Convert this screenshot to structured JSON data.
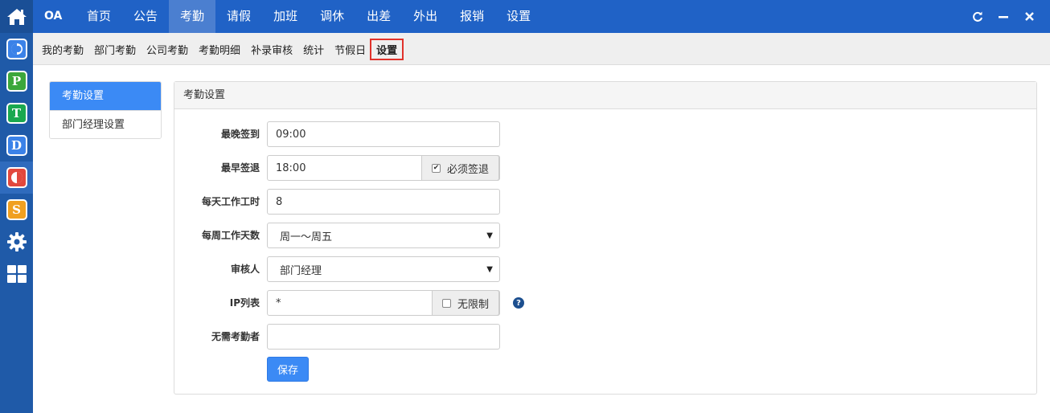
{
  "leftbar": {
    "icons": [
      {
        "name": "home-icon"
      },
      {
        "name": "app-c-icon",
        "letter": "C",
        "color": "#3b82e8"
      },
      {
        "name": "app-p-icon",
        "letter": "P",
        "color": "#3ba73b"
      },
      {
        "name": "app-t-icon",
        "letter": "T",
        "color": "#1aa84f"
      },
      {
        "name": "app-d-icon",
        "letter": "D",
        "color": "#3b82e8"
      },
      {
        "name": "app-o-icon",
        "letter": "O",
        "color": "#e2483d"
      },
      {
        "name": "app-s-icon",
        "letter": "S",
        "color": "#f0a020"
      },
      {
        "name": "gear-icon"
      },
      {
        "name": "grid-icon"
      }
    ]
  },
  "topbar": {
    "brand": "OA",
    "nav": [
      "首页",
      "公告",
      "考勤",
      "请假",
      "加班",
      "调休",
      "出差",
      "外出",
      "报销",
      "设置"
    ],
    "active_index": 2,
    "controls": [
      "refresh-icon",
      "minimize-icon",
      "close-icon"
    ]
  },
  "subnav": {
    "items": [
      "我的考勤",
      "部门考勤",
      "公司考勤",
      "考勤明细",
      "补录审核",
      "统计",
      "节假日",
      "设置"
    ],
    "active_index": 7
  },
  "sidemenu": {
    "items": [
      "考勤设置",
      "部门经理设置"
    ],
    "active_index": 0
  },
  "panel": {
    "title": "考勤设置",
    "fields": {
      "latest_checkin": {
        "label": "最晚签到",
        "value": "09:00"
      },
      "earliest_checkout": {
        "label": "最早签退",
        "value": "18:00",
        "addon": "必须签退",
        "checked": true
      },
      "daily_hours": {
        "label": "每天工作工时",
        "value": "8"
      },
      "weekly_days": {
        "label": "每周工作天数",
        "value": "周一～周五"
      },
      "approver": {
        "label": "审核人",
        "value": "部门经理"
      },
      "ip_list": {
        "label": "IP列表",
        "value": "*",
        "addon": "无限制",
        "checked": false
      },
      "exempt": {
        "label": "无需考勤者",
        "value": ""
      }
    },
    "save_label": "保存"
  }
}
